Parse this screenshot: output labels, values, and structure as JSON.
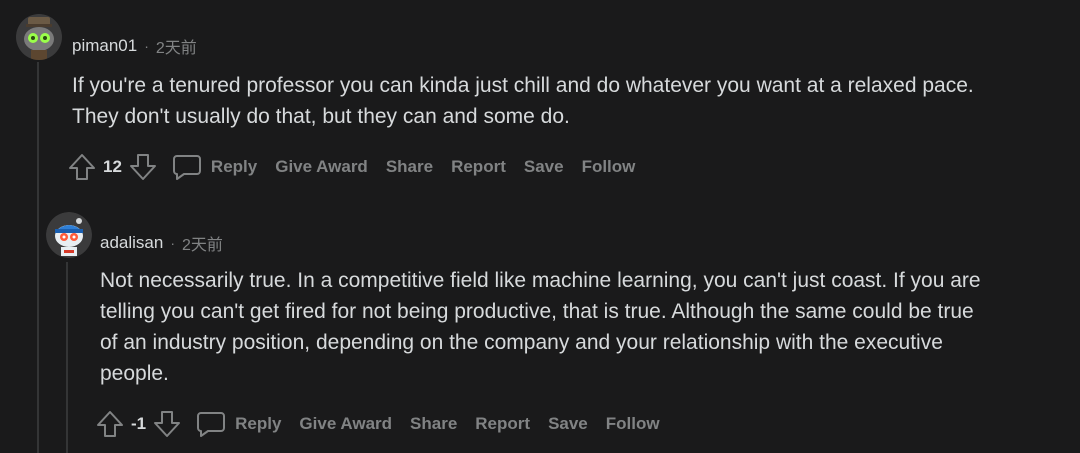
{
  "comments": [
    {
      "author": "piman01",
      "separator": "·",
      "time": "2天前",
      "text_lines": [
        "If you're a tenured professor you can kinda just chill and do whatever you want at a relaxed pace.",
        "They don't usually do that, but they can and some do."
      ],
      "score": "12",
      "actions": {
        "reply": "Reply",
        "give_award": "Give Award",
        "share": "Share",
        "report": "Report",
        "save": "Save",
        "follow": "Follow"
      }
    },
    {
      "author": "adalisan",
      "separator": "·",
      "time": "2天前",
      "text_lines": [
        "Not necessarily true. In a competitive field like machine learning, you can't just coast. If you are",
        "telling you can't get fired for not being productive, that is true. Although the same could be true",
        "of an industry position, depending on the company and your relationship with the executive",
        "people."
      ],
      "score": "-1",
      "actions": {
        "reply": "Reply",
        "give_award": "Give Award",
        "share": "Share",
        "report": "Report",
        "save": "Save",
        "follow": "Follow"
      }
    }
  ],
  "colors": {
    "background": "#1a1a1b",
    "text": "#d7dadc",
    "muted": "#818384",
    "thread_line": "#343536"
  },
  "icons": [
    "upvote-icon",
    "downvote-icon",
    "comment-bubble-icon",
    "avatar-robot",
    "avatar-snoo"
  ]
}
